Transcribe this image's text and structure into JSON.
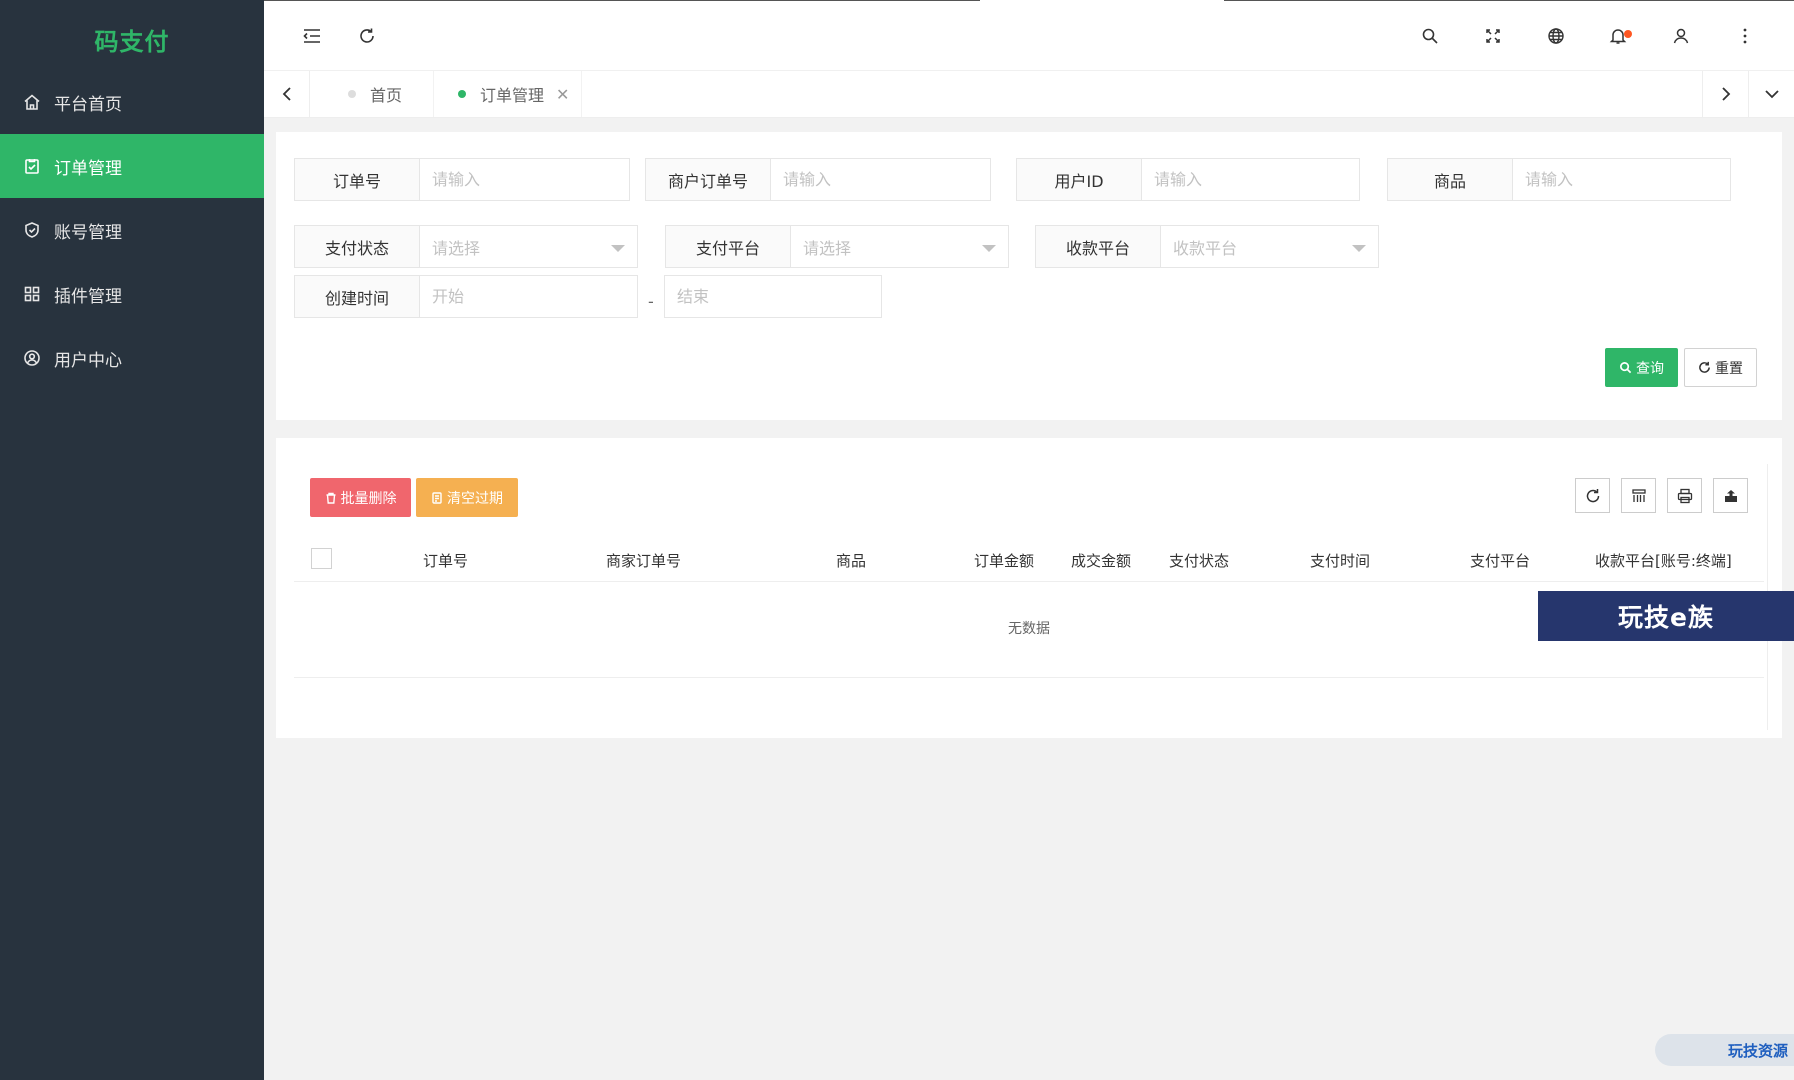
{
  "app": {
    "logo_text": "码支付"
  },
  "colors": {
    "accent": "#2fb668",
    "sidebar_bg": "#28333e",
    "danger": "#f0666d",
    "warning": "#f5b051"
  },
  "sidebar": {
    "items": [
      {
        "label": "平台首页",
        "icon": "home-icon",
        "active": false
      },
      {
        "label": "订单管理",
        "icon": "clipboard-check-icon",
        "active": true
      },
      {
        "label": "账号管理",
        "icon": "shield-check-icon",
        "active": false
      },
      {
        "label": "插件管理",
        "icon": "grid-icon",
        "active": false
      },
      {
        "label": "用户中心",
        "icon": "user-circle-icon",
        "active": false
      }
    ]
  },
  "header": {
    "icons": [
      "menu-fold-icon",
      "refresh-icon",
      "search-icon",
      "fullscreen-icon",
      "globe-icon",
      "bell-icon",
      "user-icon",
      "more-vertical-icon"
    ]
  },
  "tabs": [
    {
      "label": "首页",
      "active": false
    },
    {
      "label": "订单管理",
      "active": true,
      "closable": true
    }
  ],
  "search": {
    "fields": {
      "order_no": {
        "label": "订单号",
        "placeholder": "请输入"
      },
      "merchant_order_no": {
        "label": "商户订单号",
        "placeholder": "请输入"
      },
      "user_id": {
        "label": "用户ID",
        "placeholder": "请输入"
      },
      "product": {
        "label": "商品",
        "placeholder": "请输入"
      },
      "pay_status": {
        "label": "支付状态",
        "placeholder": "请选择"
      },
      "pay_platform": {
        "label": "支付平台",
        "placeholder": "请选择"
      },
      "receive_platform": {
        "label": "收款平台",
        "placeholder": "收款平台"
      },
      "created_time": {
        "label": "创建时间",
        "start_placeholder": "开始",
        "end_placeholder": "结束",
        "separator": "-"
      }
    },
    "query_label": "查询",
    "reset_label": "重置"
  },
  "table": {
    "batch_delete_label": "批量删除",
    "clear_expired_label": "清空过期",
    "columns": [
      "订单号",
      "商家订单号",
      "商品",
      "订单金额",
      "成交金额",
      "支付状态",
      "支付时间",
      "支付平台",
      "收款平台[账号:终端]"
    ],
    "rows": [],
    "empty_text": "无数据",
    "tools": [
      "refresh-icon",
      "columns-icon",
      "print-icon",
      "export-icon"
    ]
  },
  "watermarks": {
    "banner": "玩技e族",
    "corner": "玩技资源"
  }
}
